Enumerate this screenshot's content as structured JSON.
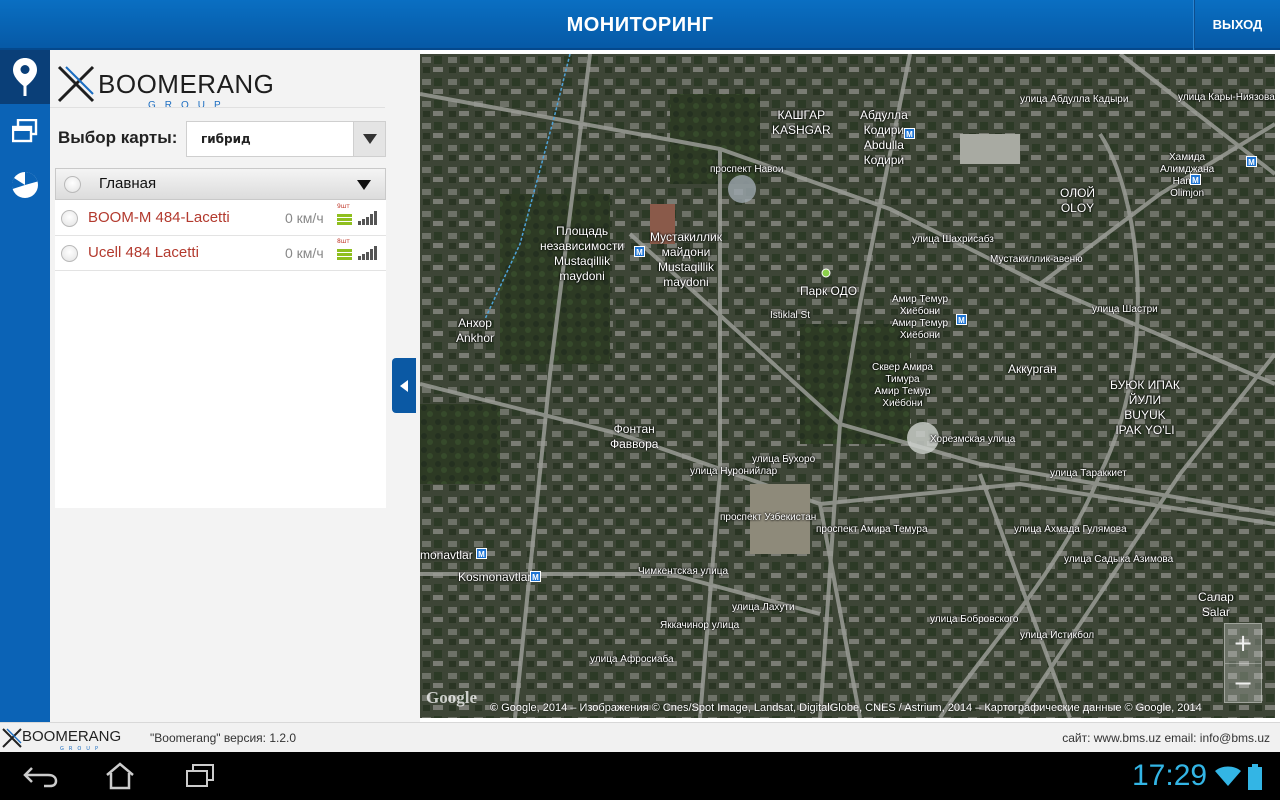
{
  "header": {
    "title": "МОНИТОРИНГ",
    "exit_label": "ВЫХОД"
  },
  "rail": {
    "items": [
      {
        "icon": "map-pin-icon",
        "active": true
      },
      {
        "icon": "windows-icon",
        "active": false
      },
      {
        "icon": "pie-chart-icon",
        "active": false
      }
    ]
  },
  "logo": {
    "text": "BOOMERANG",
    "sub": "GROUP"
  },
  "map_select": {
    "label": "Выбор карты:",
    "value": "гибрид"
  },
  "group": {
    "name": "Главная"
  },
  "vehicles": [
    {
      "name": "BOOM-M 484-Lacetti",
      "speed": "0 км/ч",
      "sat": "9шт"
    },
    {
      "name": "Ucell 484 Lacetti",
      "speed": "0 км/ч",
      "sat": "8шт"
    }
  ],
  "map": {
    "labels": [
      {
        "text": "КАШГАР\nKASHGAR"
      },
      {
        "text": "Абдулла\nКодири\nAbdulla\nКодири"
      },
      {
        "text": "проспект Навои"
      },
      {
        "text": "улица Абдулла Кадыри"
      },
      {
        "text": "улица Кары-Ниязова"
      },
      {
        "text": "Хамида\nАлимджана\nHamid\nOlimjon"
      },
      {
        "text": "ОЛОЙ\nOLOY"
      },
      {
        "text": "Площадь\nнезависимости\nMustaqillik\nmaydoni"
      },
      {
        "text": "Мустакиллик\nмайдони\nMustaqillik\nmaydoni"
      },
      {
        "text": "Парк ОДО"
      },
      {
        "text": "Istiklal St"
      },
      {
        "text": "улица Шахрисабз"
      },
      {
        "text": "Мустакиллик-авеню"
      },
      {
        "text": "Амир Темур\nХиёбони\nАмир Темур\nХиёбони"
      },
      {
        "text": "Сквер Амира\nТимура\nАмир Темур\nХиёбони"
      },
      {
        "text": "Анхор\nAnkhor"
      },
      {
        "text": "Аккурган"
      },
      {
        "text": "БУЮК ИПАК\nЙУЛИ\nBUYUK\nIPAK YO'LI"
      },
      {
        "text": "улица Шастри"
      },
      {
        "text": "Фонтан\nФаввора"
      },
      {
        "text": "улица Бухоро"
      },
      {
        "text": "улица Нуронийлар"
      },
      {
        "text": "Хорезмская улица"
      },
      {
        "text": "улица Тараккиет"
      },
      {
        "text": "проспект Узбекистан"
      },
      {
        "text": "проспект Амира Темура"
      },
      {
        "text": "monavtlar"
      },
      {
        "text": "Kosmonavtlar"
      },
      {
        "text": "Чимкентская улица"
      },
      {
        "text": "Яккачинор улица"
      },
      {
        "text": "улица Лахути"
      },
      {
        "text": "улица Бобровского"
      },
      {
        "text": "улица Истикбол"
      },
      {
        "text": "улица Ахмада Гулямова"
      },
      {
        "text": "улица Садыка Азимова"
      },
      {
        "text": "Салар\nSalar"
      },
      {
        "text": "улица Афросиаба"
      }
    ],
    "zoom_in": "+",
    "zoom_out": "−",
    "google": "Google",
    "copyright": "© Google, 2014 – Изображения © Cnes/Spot Image, Landsat, DigitalGlobe, CNES / Astrium, 2014 – Картографические данные © Google, 2014"
  },
  "footer": {
    "logo": "BOOMERANG",
    "logo_sub": "GROUP",
    "version": "\"Boomerang\" версия: 1.2.0",
    "contact": "сайт: www.bms.uz email: info@bms.uz"
  },
  "system": {
    "clock": "17:29"
  },
  "colors": {
    "header": "#0a66b7",
    "accent_blue": "#33b5e5",
    "vehicle_name": "#b33a2e",
    "sat_bars": "#8fbf1f"
  }
}
